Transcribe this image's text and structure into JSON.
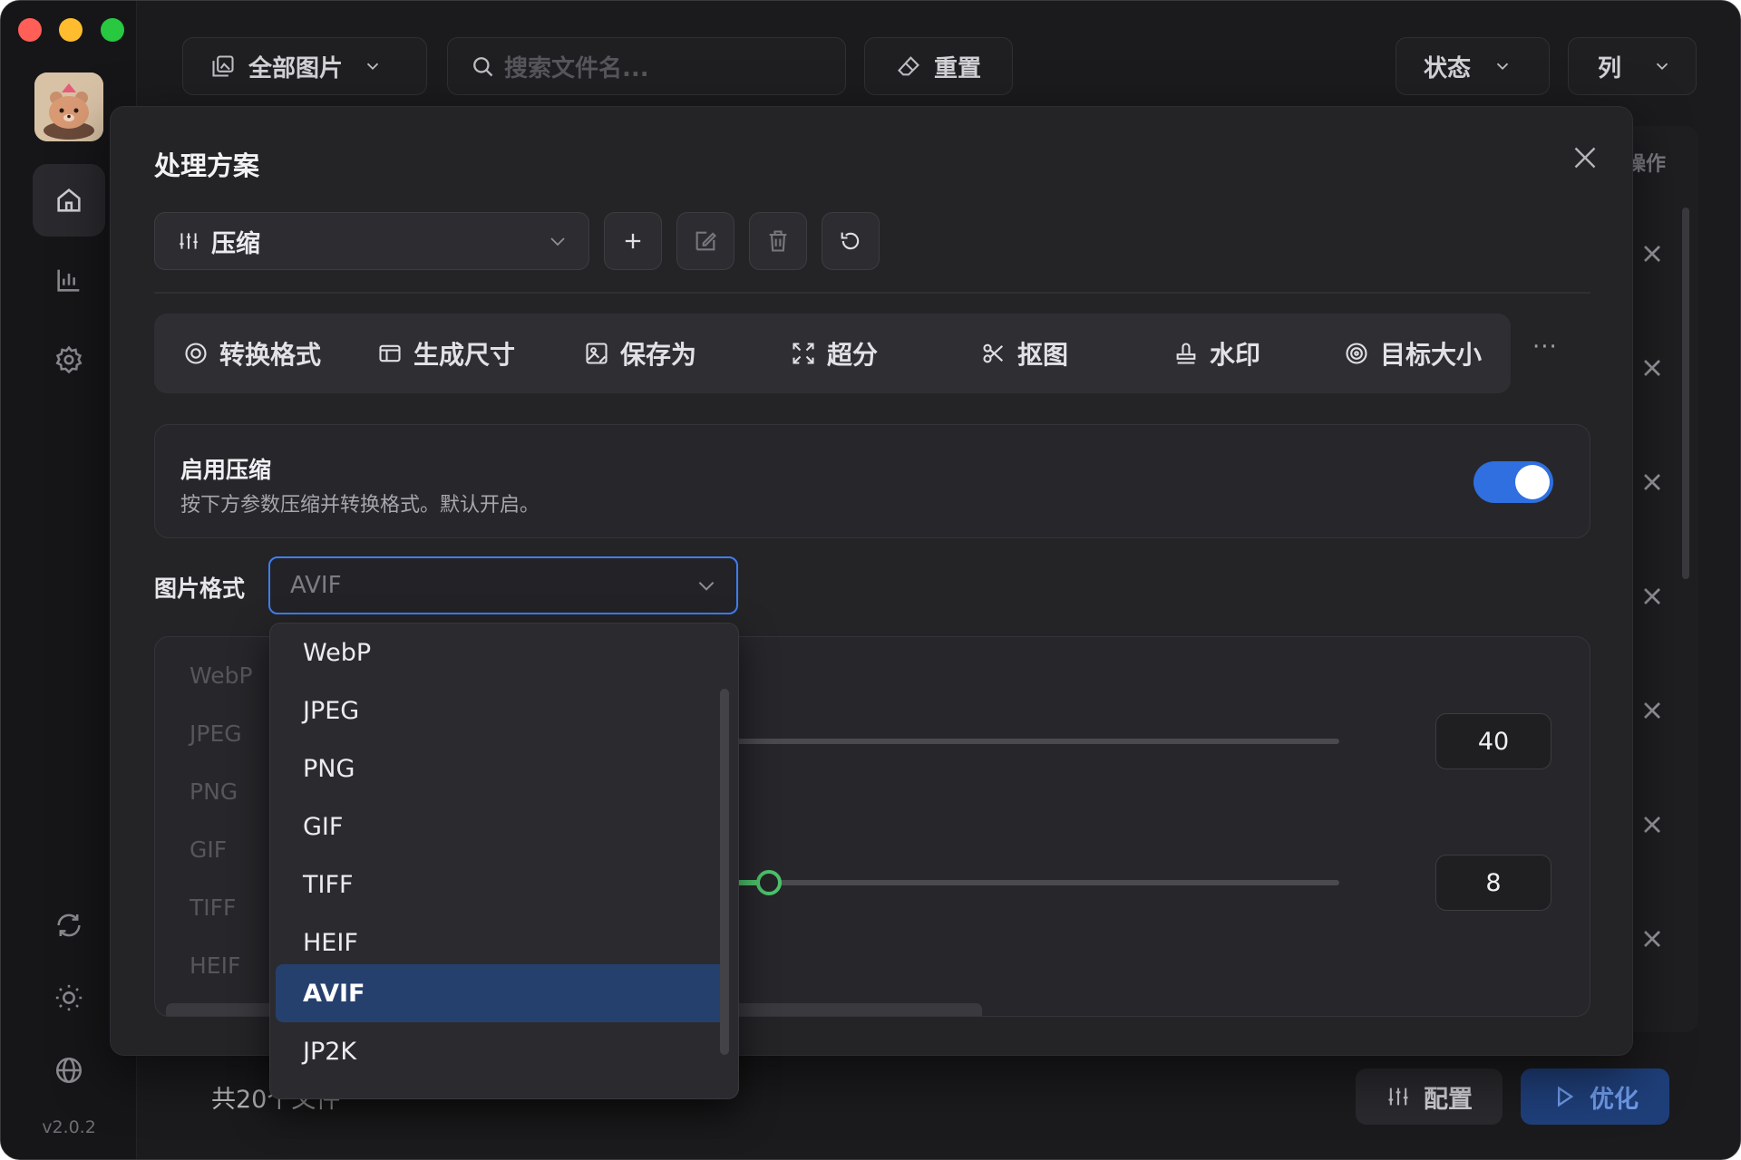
{
  "app": {
    "version": "v2.0.2"
  },
  "topbar": {
    "filter_label": "全部图片",
    "search_placeholder": "搜索文件名...",
    "reset_label": "重置",
    "status_label": "状态",
    "columns_label": "列"
  },
  "background": {
    "operation_header": "操作",
    "total_text": "共20个文件",
    "config_label": "配置",
    "optimize_label": "优化"
  },
  "modal": {
    "title": "处理方案",
    "scheme_value": "压缩",
    "tabs": [
      {
        "label": "转换格式",
        "icon": "convert-icon"
      },
      {
        "label": "生成尺寸",
        "icon": "resize-icon"
      },
      {
        "label": "保存为",
        "icon": "save-image-icon"
      },
      {
        "label": "超分",
        "icon": "upscale-icon"
      },
      {
        "label": "抠图",
        "icon": "scissors-icon"
      },
      {
        "label": "水印",
        "icon": "stamp-icon"
      },
      {
        "label": "目标大小",
        "icon": "target-icon"
      }
    ],
    "more_label": "···",
    "compress_card": {
      "title": "启用压缩",
      "description": "按下方参数压缩并转换格式。默认开启。",
      "enabled": true
    },
    "format_label": "图片格式",
    "format_value": "AVIF",
    "panel_formats": [
      "WebP",
      "JPEG",
      "PNG",
      "GIF",
      "TIFF",
      "HEIF"
    ],
    "sliders": [
      {
        "value": "40",
        "fraction": 0.08
      },
      {
        "value": "8",
        "fraction": 0.19
      }
    ]
  },
  "dropdown": {
    "options": [
      "WebP",
      "JPEG",
      "PNG",
      "GIF",
      "TIFF",
      "HEIF",
      "AVIF",
      "JP2K"
    ],
    "selected": "AVIF"
  },
  "colors": {
    "accent": "#2f6fe0",
    "slider_green": "#4cc26b",
    "selected_bg": "#26406e"
  }
}
